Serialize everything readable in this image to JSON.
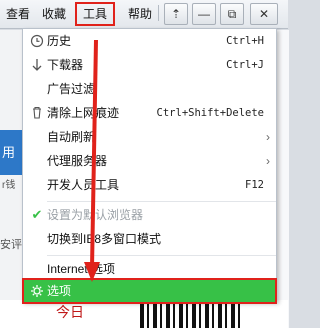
{
  "menubar": {
    "items": [
      "查看",
      "收藏",
      "工具",
      "帮助"
    ],
    "buttons": {
      "pin": "⇡",
      "minimize": "—",
      "restore": "⧉",
      "close": "✕"
    }
  },
  "dropdown": {
    "items": [
      {
        "label": "历史",
        "shortcut": "Ctrl+H",
        "icon": "clock-icon"
      },
      {
        "label": "下载器",
        "shortcut": "Ctrl+J",
        "icon": "download-icon"
      },
      {
        "label": "广告过滤",
        "shortcut": "",
        "icon": ""
      },
      {
        "label": "清除上网痕迹",
        "shortcut": "Ctrl+Shift+Delete",
        "icon": "trash-icon"
      },
      {
        "label": "自动刷新",
        "shortcut": "",
        "icon": "",
        "submenu": true
      },
      {
        "label": "代理服务器",
        "shortcut": "",
        "icon": "",
        "submenu": true
      },
      {
        "label": "开发人员工具",
        "shortcut": "F12",
        "icon": ""
      },
      {
        "label": "设置为默认浏览器",
        "shortcut": "",
        "icon": "check-icon",
        "disabled": true
      },
      {
        "label": "切换到IE8多窗口模式",
        "shortcut": "",
        "icon": ""
      },
      {
        "label": "Internet 选项",
        "shortcut": "",
        "icon": ""
      },
      {
        "label": "选项",
        "shortcut": "",
        "icon": "gear-icon",
        "selected": true
      }
    ]
  },
  "background": {
    "blue_tab": "用",
    "side_text_1": "r钱",
    "side_text_2": "安评",
    "today": "今日"
  },
  "colors": {
    "highlight": "#37c147",
    "annotation": "#e0221b"
  }
}
